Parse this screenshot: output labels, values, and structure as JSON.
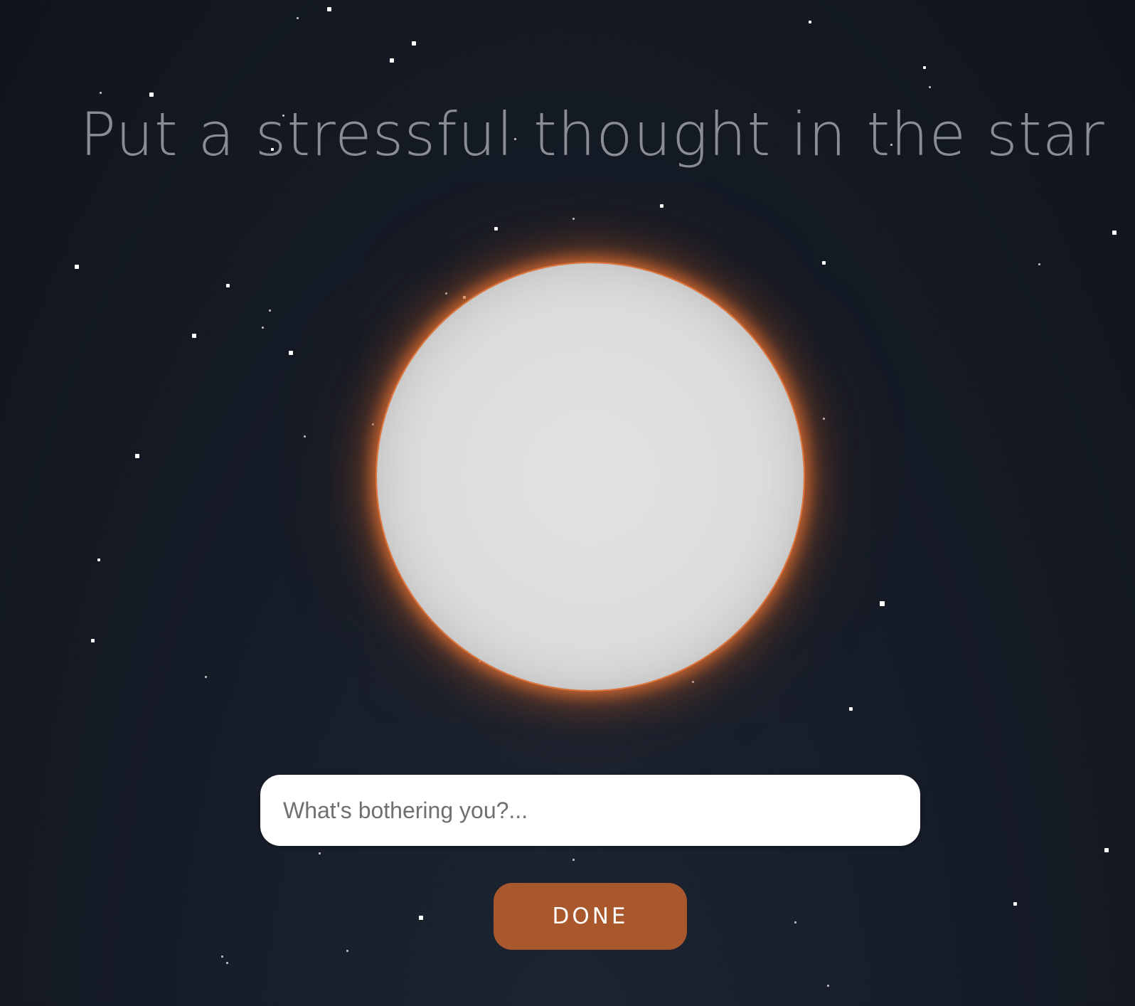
{
  "page": {
    "title": "Put a stressful thought in the star"
  },
  "input": {
    "placeholder": "What's bothering you?...",
    "value": ""
  },
  "buttons": {
    "done_label": "DONE"
  },
  "colors": {
    "background": "#151b26",
    "title": "#8a8d93",
    "star_fill": "#dcdcdc",
    "star_glow": "#de6e32",
    "button": "#a9582e",
    "button_text": "#ffffff"
  }
}
